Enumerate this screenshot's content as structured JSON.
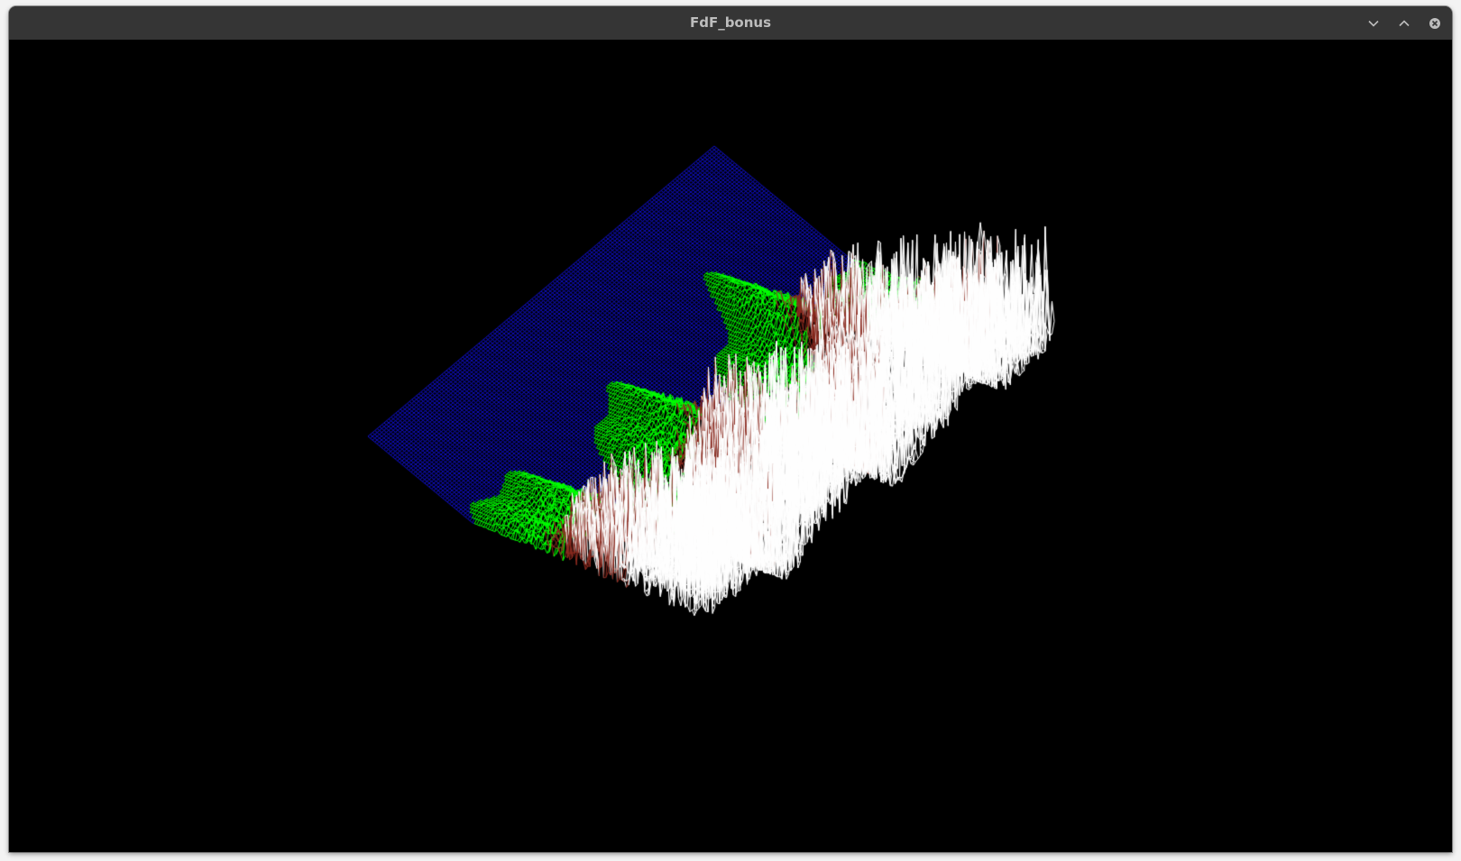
{
  "window": {
    "title": "FdF_bonus"
  },
  "controls": {
    "minimize_icon": "chevron-down-icon",
    "maximize_icon": "chevron-up-icon",
    "close_icon": "close-circle-icon"
  },
  "render": {
    "background": "#000000",
    "height_colors": {
      "water": "#1010d0",
      "lowland": "#00ff00",
      "mountain": "#8b2a1f",
      "snow": "#ffffff"
    }
  }
}
